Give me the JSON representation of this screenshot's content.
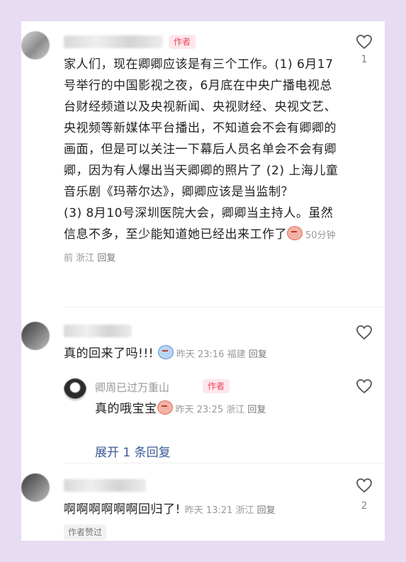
{
  "comments": [
    {
      "author_badge": "作者",
      "text": "家人们，现在卿卿应该是有三个工作。(1) 6月17号举行的中国影视之夜，6月底在中央广播电视总台财经频道以及央视新闻、央视财经、央视文艺、央视频等新媒体平台播出，不知道会不会有卿卿的画面，但是可以关注一下幕后人员名单会不会有卿卿，因为有人爆出当天卿卿的照片了 (2) 上海儿童音乐剧《玛蒂尔达》，卿卿应该是当监制？\n(3) 8月10号深圳医院大会，卿卿当主持人。虽然信息不多，至少能知道她已经出来工作了",
      "time": "50分钟前",
      "location": "浙江",
      "reply_label": "回复",
      "likes": "1",
      "emoji": "crying-face"
    },
    {
      "text": "真的回来了吗!!!",
      "time": "昨天 23:16",
      "location": "福建",
      "reply_label": "回复",
      "emoji": "shocked-face",
      "replies": [
        {
          "username": "卿周已过万重山",
          "author_badge": "作者",
          "text": "真的哦宝宝",
          "time": "昨天 23:25",
          "location": "浙江",
          "reply_label": "回复",
          "emoji": "crying-face"
        }
      ],
      "expand_label": "展开 1 条回复"
    },
    {
      "text": "啊啊啊啊啊啊回归了!",
      "time": "昨天 13:21",
      "location": "浙江",
      "reply_label": "回复",
      "likes": "2",
      "tag": "作者赞过"
    }
  ]
}
